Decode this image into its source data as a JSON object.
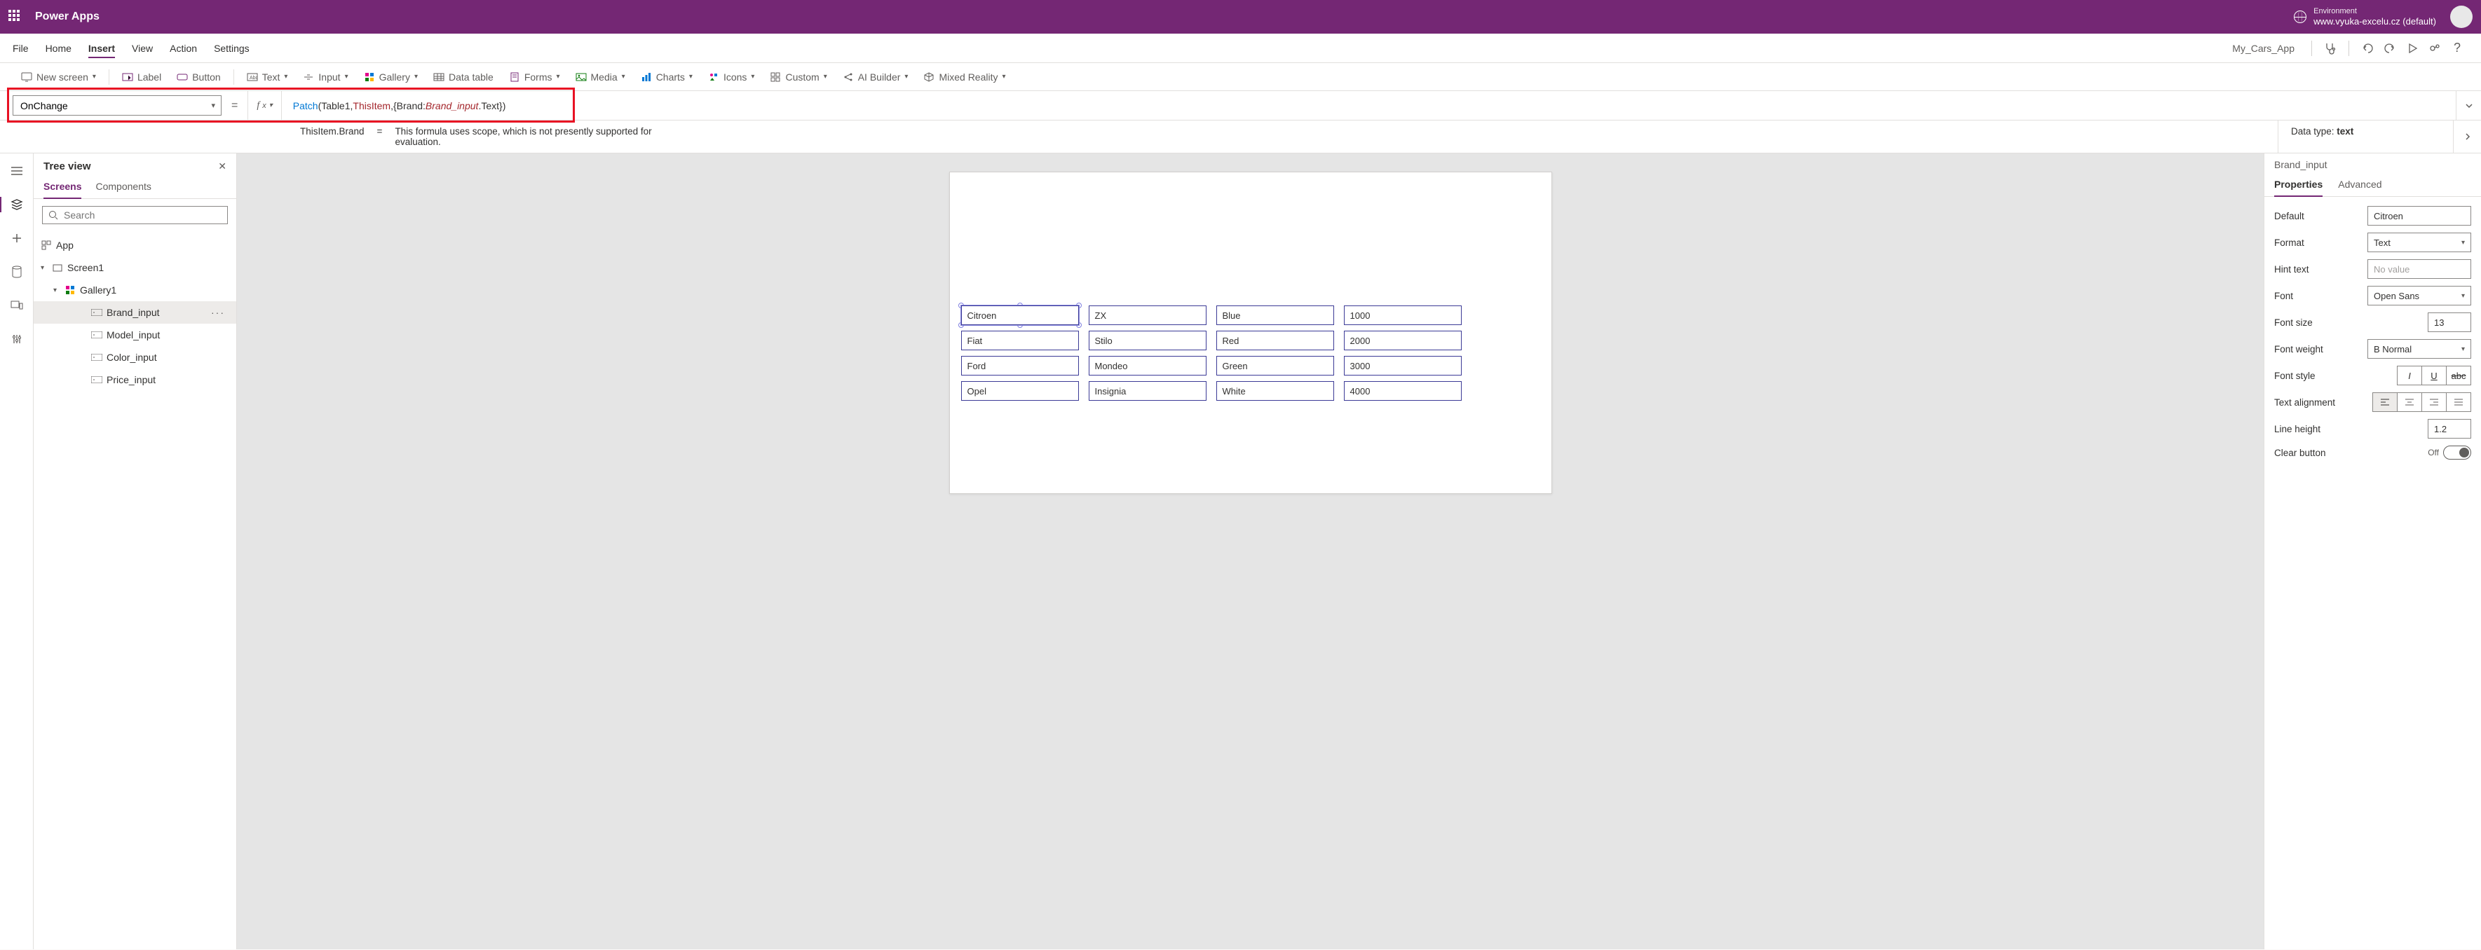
{
  "header": {
    "app_title": "Power Apps",
    "env_label": "Environment",
    "env_name": "www.vyuka-excelu.cz (default)"
  },
  "menu": {
    "items": [
      "File",
      "Home",
      "Insert",
      "View",
      "Action",
      "Settings"
    ],
    "active_index": 2,
    "app_name": "My_Cars_App"
  },
  "ribbon": {
    "new_screen": "New screen",
    "label": "Label",
    "button": "Button",
    "text": "Text",
    "input": "Input",
    "gallery": "Gallery",
    "data_table": "Data table",
    "forms": "Forms",
    "media": "Media",
    "charts": "Charts",
    "icons": "Icons",
    "custom": "Custom",
    "ai_builder": "AI Builder",
    "mixed_reality": "Mixed Reality"
  },
  "formula": {
    "property": "OnChange",
    "fx": "fx",
    "tokens": {
      "patch": "Patch",
      "open": "(",
      "t1": "Table1",
      "c1": ",",
      "thisitem": "ThisItem",
      "c2": ",",
      "brace_o": "{",
      "brand": "Brand",
      "colon": ":",
      "brand_input": "Brand_input",
      "dot": ".",
      "text": "Text",
      "brace_c": "}",
      "close": ")"
    }
  },
  "info": {
    "lhs": "ThisItem.Brand",
    "eq": "=",
    "msg": "This formula uses scope, which is not presently supported for evaluation.",
    "dt_label": "Data type: ",
    "dt_value": "text"
  },
  "tree": {
    "title": "Tree view",
    "tabs": [
      "Screens",
      "Components"
    ],
    "active_tab": 0,
    "search_ph": "Search",
    "nodes": {
      "app": "App",
      "screen": "Screen1",
      "gallery": "Gallery1",
      "brand": "Brand_input",
      "model": "Model_input",
      "color": "Color_input",
      "price": "Price_input"
    }
  },
  "canvas": {
    "rows": [
      {
        "brand": "Citroen",
        "model": "ZX",
        "color": "Blue",
        "price": "1000"
      },
      {
        "brand": "Fiat",
        "model": "Stilo",
        "color": "Red",
        "price": "2000"
      },
      {
        "brand": "Ford",
        "model": "Mondeo",
        "color": "Green",
        "price": "3000"
      },
      {
        "brand": "Opel",
        "model": "Insignia",
        "color": "White",
        "price": "4000"
      }
    ]
  },
  "props": {
    "control_name": "Brand_input",
    "tabs": [
      "Properties",
      "Advanced"
    ],
    "active_tab": 0,
    "rows": {
      "default": {
        "label": "Default",
        "value": "Citroen"
      },
      "format": {
        "label": "Format",
        "value": "Text"
      },
      "hint": {
        "label": "Hint text",
        "value": "No value"
      },
      "font": {
        "label": "Font",
        "value": "Open Sans"
      },
      "font_size": {
        "label": "Font size",
        "value": "13"
      },
      "font_weight": {
        "label": "Font weight",
        "value": "B  Normal"
      },
      "font_style": {
        "label": "Font style"
      },
      "text_align": {
        "label": "Text alignment"
      },
      "line_height": {
        "label": "Line height",
        "value": "1.2"
      },
      "clear": {
        "label": "Clear button",
        "value": "Off"
      }
    }
  }
}
